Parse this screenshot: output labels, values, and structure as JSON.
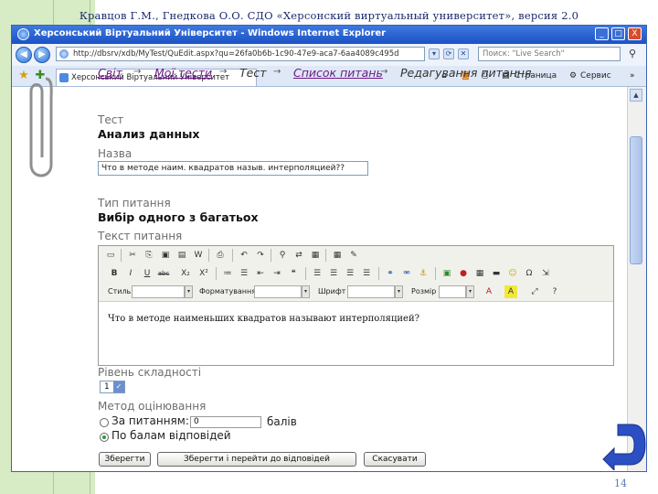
{
  "slide": {
    "header": "Кравцов Г.М., Гнедкова О.О. СДО «Херсонский виртуальный университет», версия 2.0",
    "page_number": "14"
  },
  "window": {
    "title": "Херсонський Віртуальний Університет - Windows Internet Explorer",
    "minimize": "_",
    "maximize": "□",
    "close": "X"
  },
  "address": {
    "url": "http://dbsrv/xdb/MyTest/QuEdit.aspx?qu=26fa0b6b-1c90-47e9-aca7-6aa4089c495d",
    "search_placeholder": "Поиск: \"Live Search\""
  },
  "tabs": {
    "active_tab": "Херсонський Віртуальний Університет",
    "page_menu": "Страница",
    "tools_menu": "Сервис",
    "more": "»"
  },
  "breadcrumb": {
    "items": [
      "Світ",
      "Мої тести",
      "Тест",
      "Список питань",
      "Редагування питання"
    ],
    "arrow": "→"
  },
  "form": {
    "test_label": "Тест",
    "test_value": "Анализ данных",
    "name_label": "Назва",
    "name_value": "Что в методе наим. квадратов назыв. интерполяцией??",
    "type_label": "Тип питання",
    "type_value": "Вибір одного з багатьох",
    "text_label": "Текст питання",
    "question_text": "Что в методе наименьших квадратов называют интерполяцией?",
    "difficulty_label": "Рівень складності",
    "difficulty_value": "1",
    "method_label": "Метод оцінювання",
    "option_by_question": "За питанням:",
    "score_value": "0",
    "score_unit": "балів",
    "option_by_answers": "По балам відповідей"
  },
  "editor_toolbar": {
    "row2": [
      "B",
      "I",
      "U",
      "abc",
      "X₂",
      "X²"
    ],
    "style_label": "Стиль",
    "format_label": "Форматування",
    "font_label": "Шрифт",
    "size_label": "Розмір"
  },
  "buttons": {
    "save": "Зберегти",
    "save_go": "Зберегти і перейти до відповідей",
    "cancel": "Скасувати"
  },
  "colors": {
    "titlebar": "#1b52c5",
    "link": "#6b1b86",
    "notebook_green": "#d7ecc4",
    "return_arrow": "#2c4fc4"
  }
}
